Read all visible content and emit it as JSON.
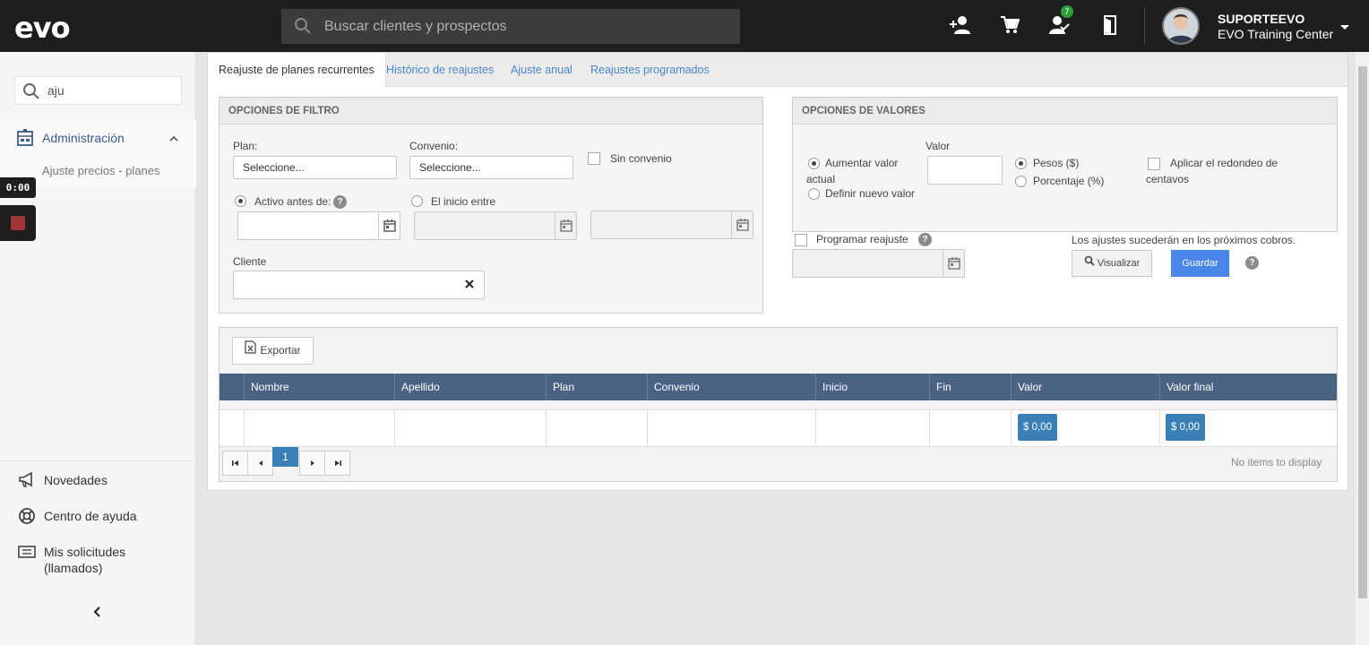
{
  "topbar": {
    "logo": "evo",
    "search_placeholder": "Buscar clientes y prospectos",
    "notification_count": "7",
    "user_name": "SUPORTEEVO",
    "user_org": "EVO Training Center"
  },
  "sidebar": {
    "search_value": "aju",
    "menu_label": "Administración",
    "submenu_item": "Ajuste precios - planes",
    "timer": "0:00",
    "links": [
      "Novedades",
      "Centro de ayuda",
      "Mis solicitudes (llamados)"
    ]
  },
  "tabs": [
    "Reajuste de planes recurrentes",
    "Histórico de reajustes",
    "Ajuste anual",
    "Reajustes programados"
  ],
  "filter": {
    "title": "OPCIONES DE FILTRO",
    "plan_label": "Plan:",
    "plan_value": "Seleccione...",
    "convenio_label": "Convenio:",
    "convenio_value": "Seleccione...",
    "sin_convenio": "Sin convenio",
    "activo_antes": "Activo antes de:",
    "inicio_entre": "El inicio entre",
    "cliente_label": "Cliente"
  },
  "values": {
    "title": "OPCIONES DE VALORES",
    "valor_label": "Valor",
    "aumentar": "Aumentar valor",
    "actual": "actual",
    "definir": "Definir nuevo valor",
    "pesos": "Pesos ($)",
    "porcentaje": "Porcentaje (%)",
    "redondeo_1": "Aplicar el redondeo de",
    "redondeo_2": "centavos",
    "programar": "Programar reajuste",
    "info": "Los ajustes sucederán en los próximos cobros.",
    "visualizar": "Visualizar",
    "guardar": "Guardar"
  },
  "grid": {
    "export_label": "Exportar",
    "columns": [
      "Nombre",
      "Apellido",
      "Plan",
      "Convenio",
      "Inicio",
      "Fin",
      "Valor",
      "Valor final"
    ],
    "row_valor": "$ 0,00",
    "row_valor_final": "$ 0,00",
    "current_page": "1",
    "empty_text": "No items to display"
  },
  "colors": {
    "topbar": "#1e1e1e",
    "grid_header": "#4a6385",
    "accent_button": "#4a86e8",
    "money_badge": "#3a7fb5",
    "link": "#4a86c5"
  }
}
